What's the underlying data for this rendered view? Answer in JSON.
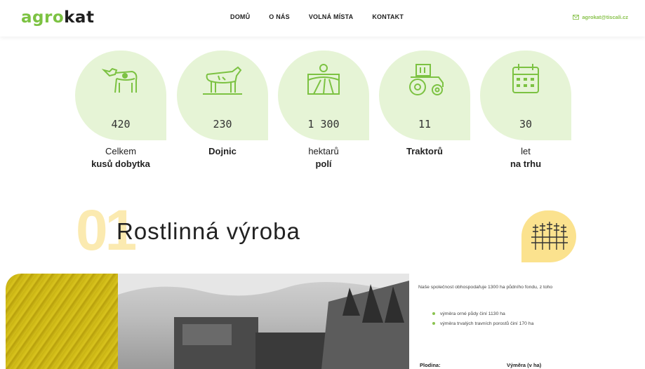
{
  "header": {
    "logo_part1": "agro",
    "logo_part2": "kat",
    "nav": [
      "DOMŮ",
      "O NÁS",
      "VOLNÁ MÍSTA",
      "KONTAKT"
    ],
    "email": "agrokat@tiscali.cz"
  },
  "stats": [
    {
      "icon": "cow-icon",
      "value": "420",
      "line1": "Celkem",
      "line2": "kusů dobytka"
    },
    {
      "icon": "dairy-cow-icon",
      "value": "230",
      "line1": "Dojnic",
      "line2": ""
    },
    {
      "icon": "field-icon",
      "value": "1 300",
      "line1": "hektarů",
      "line2": "polí"
    },
    {
      "icon": "tractor-icon",
      "value": "11",
      "line1": "Traktorů",
      "line2": ""
    },
    {
      "icon": "calendar-icon",
      "value": "30",
      "line1": "let",
      "line2": "na trhu"
    }
  ],
  "section": {
    "number": "01",
    "title": "Rostlinná výroba",
    "badge_icon": "wheat-icon"
  },
  "content": {
    "intro": "Naše společnost obhospodařuje 1300 ha půdního fondu, z toho",
    "bullets": [
      "výměra orné půdy činí 1130 ha",
      "výměra trvalých travních porostů činí 170 ha"
    ],
    "table_headers": [
      "Plodina:",
      "Výměra (v ha)"
    ]
  },
  "colors": {
    "accent_green": "#7cc242",
    "light_green": "#e6f4d6",
    "yellow": "#fbe28e"
  }
}
